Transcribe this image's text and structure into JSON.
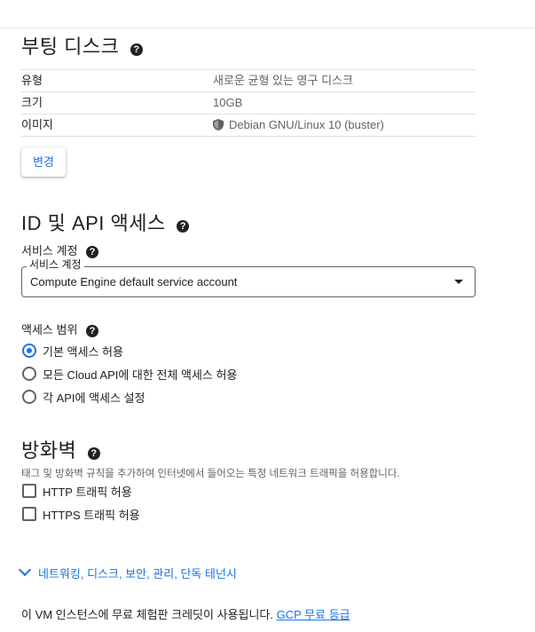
{
  "boot_disk": {
    "title": "부팅 디스크",
    "rows": [
      {
        "key": "유형",
        "value": "새로운 균형 있는 영구 디스크"
      },
      {
        "key": "크기",
        "value": "10GB"
      },
      {
        "key": "이미지",
        "value": "Debian GNU/Linux 10 (buster)"
      }
    ],
    "change_button": "변경"
  },
  "identity": {
    "title": "ID 및 API 액세스",
    "service_account_label": "서비스 계정",
    "service_account_field_legend": "서비스 계정",
    "service_account_value": "Compute Engine default service account",
    "access_scope_label": "액세스 범위",
    "options": [
      {
        "label": "기본 액세스 허용",
        "selected": true
      },
      {
        "label": "모든 Cloud API에 대한 전체 액세스 허용",
        "selected": false
      },
      {
        "label": "각 API에 액세스 설정",
        "selected": false
      }
    ]
  },
  "firewall": {
    "title": "방화벽",
    "description": "태그 및 방화벽 규칙을 추가하여 인터넷에서 들어오는 특정 네트워크 트래픽을 허용합니다.",
    "checks": [
      {
        "label": "HTTP 트래픽 허용",
        "checked": false
      },
      {
        "label": "HTTPS 트래픽 허용",
        "checked": false
      }
    ]
  },
  "advanced_link": "네트워킹, 디스크, 보안, 관리, 단독 테넌시",
  "footer": {
    "text": "이 VM 인스턴스에 무료 체험판 크레딧이 사용됩니다.",
    "link": "GCP 무료 등급"
  },
  "colors": {
    "accent": "#1a73e8",
    "text": "#202124",
    "muted": "#5f6368"
  },
  "icons": {
    "help": "help-circle-icon",
    "shield": "shield-icon",
    "expand": "chevron-down-icon",
    "dropdown": "dropdown-caret-icon"
  }
}
